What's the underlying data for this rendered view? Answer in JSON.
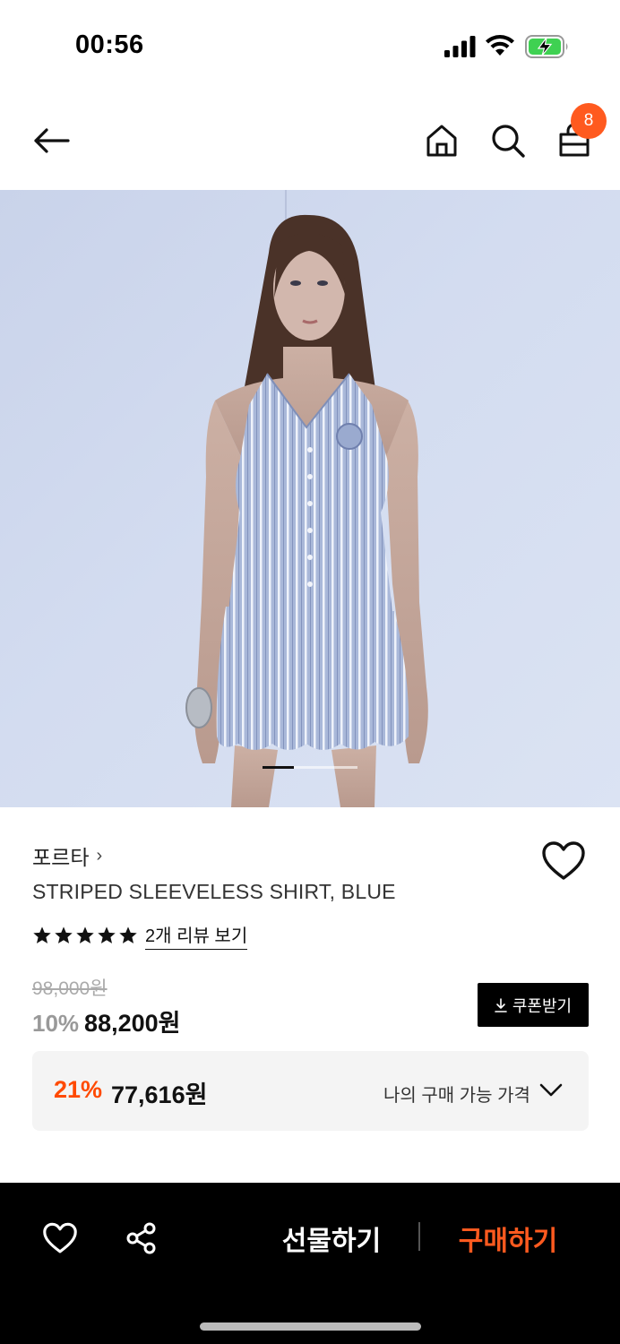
{
  "status_bar": {
    "time": "00:56",
    "icons": [
      "signal-icon",
      "wifi-icon",
      "battery-charging-icon"
    ]
  },
  "top_nav": {
    "icons": [
      "back-arrow-icon",
      "home-icon",
      "search-icon",
      "shopping-bag-icon"
    ],
    "cart_count": "8"
  },
  "hero": {
    "slide_index": 1,
    "slide_fraction": 0.33
  },
  "product": {
    "brand": "포르타",
    "brand_chevron": "›",
    "name": "STRIPED SLEEVELESS SHIRT, BLUE",
    "rating_stars": 5,
    "review_link": "2개 리뷰 보기",
    "original_price": "98,000원",
    "discount_rate": "10%",
    "sale_price": "88,200원",
    "coupon_label": "쿠폰받기"
  },
  "best_price": {
    "rate": "21%",
    "price": "77,616원",
    "label": "나의 구매 가능 가격"
  },
  "bottom_bar": {
    "gift_label": "선물하기",
    "buy_label": "구매하기"
  },
  "colors": {
    "accent": "#ff5a1f",
    "best_rate": "#ff4a00",
    "bottom_bar_bg": "#000000"
  }
}
